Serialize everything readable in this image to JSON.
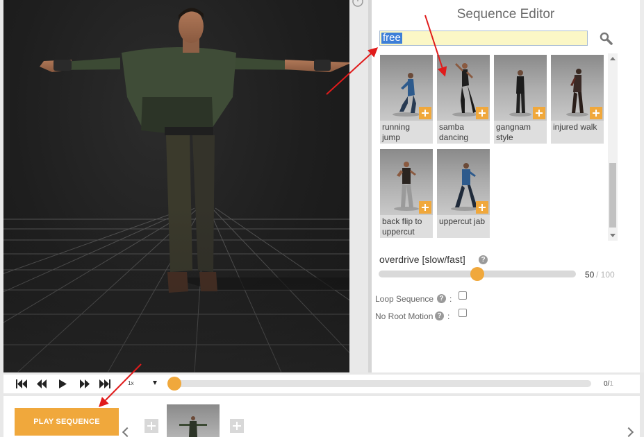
{
  "editor": {
    "title": "Sequence Editor",
    "search_value": "free",
    "search_icon": "magnifier-icon",
    "animations": [
      {
        "line1": "running",
        "line2": "jump"
      },
      {
        "line1": "samba",
        "line2": "dancing"
      },
      {
        "line1": "gangnam",
        "line2": "style"
      },
      {
        "line1": "injured walk",
        "line2": ""
      },
      {
        "line1": "back flip to",
        "line2": "uppercut"
      },
      {
        "line1": "uppercut jab",
        "line2": ""
      }
    ],
    "overdrive": {
      "label": "overdrive [slow/fast]",
      "help": "?",
      "value": "50",
      "max": "/ 100",
      "level": 50
    },
    "options": [
      {
        "label": "Loop Sequence",
        "help": "?",
        "colon": ":",
        "checked": false
      },
      {
        "label": "No Root Motion",
        "help": "?",
        "colon": ":",
        "checked": false
      }
    ]
  },
  "transport": {
    "speed": "1x",
    "frame_current": "0/",
    "frame_total": "1",
    "icons": [
      "skip-to-start-icon",
      "step-back-icon",
      "play-icon",
      "step-forward-icon",
      "skip-to-end-icon"
    ]
  },
  "sequence": {
    "play_label": "PLAY SEQUENCE"
  },
  "colors": {
    "accent": "#f0a83c",
    "annotation": "#e01b1b",
    "search_highlight": "#3d7fd8"
  }
}
